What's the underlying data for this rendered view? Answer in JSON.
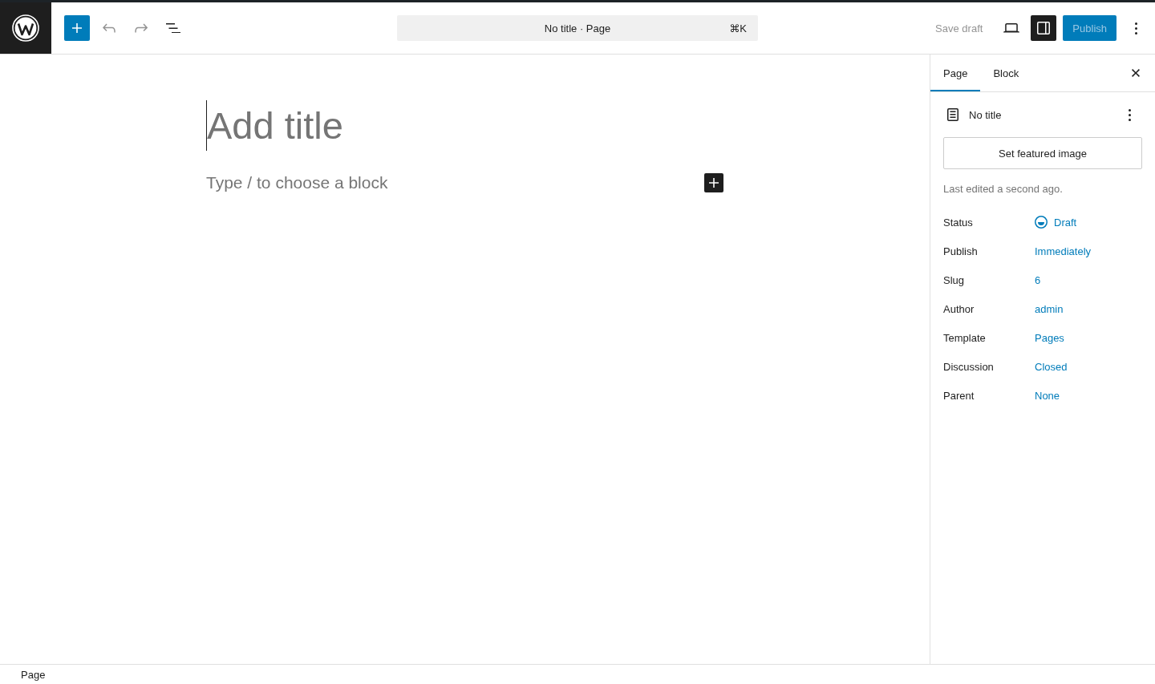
{
  "header": {
    "toolbar": [
      {
        "kind": "inserter",
        "disabled": false
      },
      {
        "kind": "undo",
        "disabled": true
      },
      {
        "kind": "redo",
        "disabled": true
      },
      {
        "kind": "list-view",
        "disabled": false
      }
    ],
    "command_bar": {
      "title": "No title · Page",
      "shortcut": "⌘K"
    },
    "save_draft": {
      "label": "Save draft",
      "disabled": true
    },
    "settings_toggle": {
      "pressed": true
    },
    "publish": {
      "label": "Publish",
      "disabled": true
    }
  },
  "editor": {
    "title": {
      "placeholder": "Add title"
    },
    "block": {
      "placeholder": "Type / to choose a block"
    }
  },
  "sidebar": {
    "tabs": [
      {
        "label": "Page",
        "selected": true
      },
      {
        "label": "Block",
        "selected": false
      }
    ],
    "document": {
      "title": "No title"
    },
    "featured_image_button": "Set featured image",
    "last_edited": "Last edited a second ago.",
    "fields": [
      {
        "kind": "status",
        "label": "Status",
        "value": "Draft"
      },
      {
        "kind": "link",
        "label": "Publish",
        "value": "Immediately"
      },
      {
        "kind": "link",
        "label": "Slug",
        "value": "6"
      },
      {
        "kind": "link",
        "label": "Author",
        "value": "admin"
      },
      {
        "kind": "link",
        "label": "Template",
        "value": "Pages"
      },
      {
        "kind": "link",
        "label": "Discussion",
        "value": "Closed"
      },
      {
        "kind": "link",
        "label": "Parent",
        "value": "None"
      }
    ]
  },
  "footer": {
    "breadcrumb": "Page"
  }
}
